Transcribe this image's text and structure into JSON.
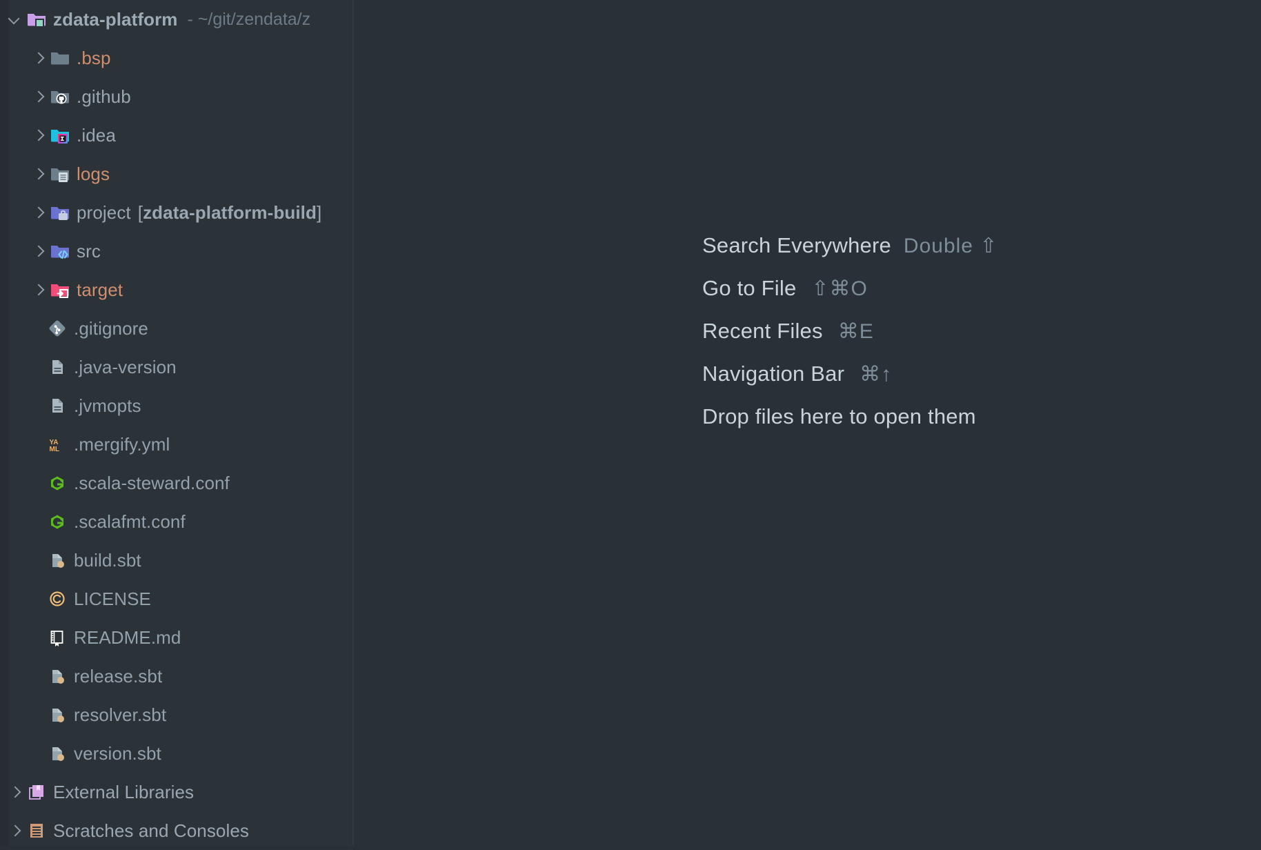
{
  "window": {
    "background_color": "#293037",
    "panel_color": "#2b3238"
  },
  "project_tree": {
    "root": {
      "name": "zdata-platform",
      "path": "- ~/git/zendata/z",
      "icon": "module-folder-icon",
      "expanded": true
    },
    "folders": [
      {
        "name": ".bsp",
        "icon": "folder-icon",
        "color": "#cf8e6d",
        "expanded": false
      },
      {
        "name": ".github",
        "icon": "github-folder-icon",
        "color": "#9aa7b0",
        "expanded": false
      },
      {
        "name": ".idea",
        "icon": "idea-folder-icon",
        "color": "#9aa7b0",
        "expanded": false
      },
      {
        "name": "logs",
        "icon": "logs-folder-icon",
        "color": "#cf8e6d",
        "expanded": false
      },
      {
        "name": "project",
        "module": "[zdata-platform-build]",
        "icon": "module-folder-icon",
        "color": "#9aa7b0",
        "expanded": false
      },
      {
        "name": "src",
        "icon": "source-folder-icon",
        "color": "#9aa7b0",
        "expanded": false
      },
      {
        "name": "target",
        "icon": "target-folder-icon",
        "color": "#cf8e6d",
        "expanded": false
      }
    ],
    "files": [
      {
        "name": ".gitignore",
        "icon": "git-icon"
      },
      {
        "name": ".java-version",
        "icon": "text-file-icon"
      },
      {
        "name": ".jvmopts",
        "icon": "text-file-icon"
      },
      {
        "name": ".mergify.yml",
        "icon": "yaml-icon"
      },
      {
        "name": ".scala-steward.conf",
        "icon": "hocon-icon"
      },
      {
        "name": ".scalafmt.conf",
        "icon": "hocon-icon"
      },
      {
        "name": "build.sbt",
        "icon": "sbt-icon"
      },
      {
        "name": "LICENSE",
        "icon": "license-icon"
      },
      {
        "name": "README.md",
        "icon": "readme-icon"
      },
      {
        "name": "release.sbt",
        "icon": "sbt-icon"
      },
      {
        "name": "resolver.sbt",
        "icon": "sbt-icon"
      },
      {
        "name": "version.sbt",
        "icon": "sbt-icon"
      }
    ],
    "bottom_nodes": [
      {
        "name": "External Libraries",
        "icon": "libraries-icon",
        "expanded": false
      },
      {
        "name": "Scratches and Consoles",
        "icon": "scratches-icon",
        "expanded": false
      }
    ]
  },
  "editor_placeholder": {
    "shortcuts": [
      {
        "action": "Search Everywhere",
        "keys": "Double ⇧"
      },
      {
        "action": "Go to File",
        "keys": "⇧⌘O"
      },
      {
        "action": "Recent Files",
        "keys": "⌘E"
      },
      {
        "action": "Navigation Bar",
        "keys": "⌘↑"
      }
    ],
    "drop_hint": "Drop files here to open them"
  }
}
